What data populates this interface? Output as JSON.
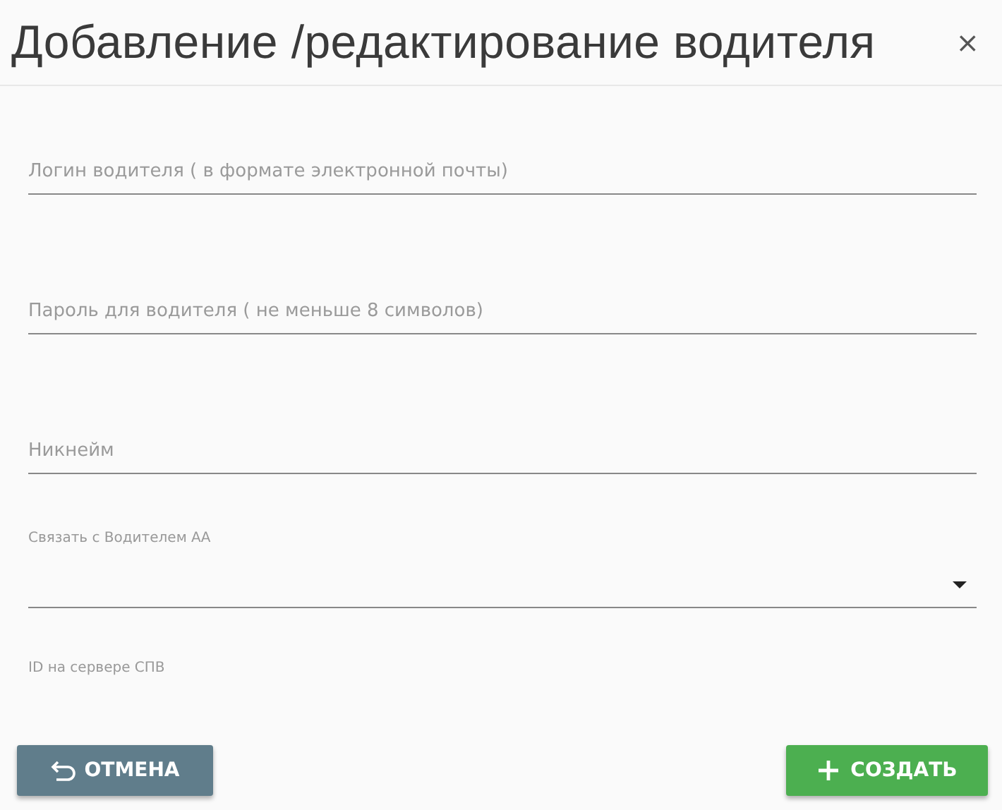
{
  "dialog": {
    "title": "Добавление /редактирование водителя",
    "close": "×"
  },
  "fields": [
    {
      "kind": "text",
      "placeholder": "Логин водителя ( в формате электронной почты)"
    },
    {
      "kind": "text",
      "placeholder": "Пароль для водителя ( не меньше 8 символов)"
    },
    {
      "kind": "text",
      "placeholder": "Никнейм"
    },
    {
      "kind": "select",
      "label": "Связать с Водителем АА"
    },
    {
      "kind": "static",
      "label": "ID на сервере СПВ"
    }
  ],
  "buttons": [
    {
      "kind": "cancel",
      "label": "ОТМЕНА"
    },
    {
      "kind": "create",
      "label": "СОЗДАТЬ"
    }
  ]
}
